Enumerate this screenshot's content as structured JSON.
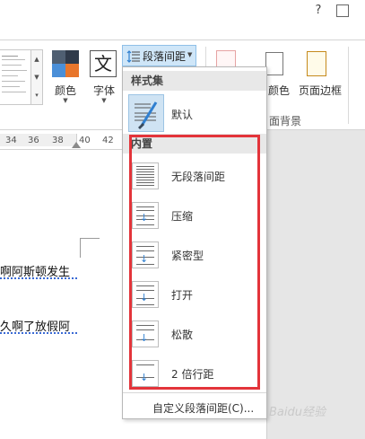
{
  "titlebar": {
    "help": "?",
    "restore": "⊡"
  },
  "ribbon": {
    "color_label": "颜色",
    "font_label": "字体",
    "spacing_button_label": "段落间距",
    "page_color_label": "颜色",
    "page_border_label": "页面边框",
    "page_background_group": "面背景"
  },
  "ruler": {
    "numbers": [
      "34",
      "36",
      "38",
      "40",
      "42"
    ]
  },
  "document": {
    "line1": "啊阿斯顿发生",
    "line2": "久啊了放假阿"
  },
  "menu": {
    "style_set_header": "样式集",
    "default_label": "默认",
    "builtin_header": "内置",
    "items": [
      {
        "label": "无段落间距"
      },
      {
        "label": "压缩"
      },
      {
        "label": "紧密型"
      },
      {
        "label": "打开"
      },
      {
        "label": "松散"
      },
      {
        "label": "2 倍行距"
      }
    ],
    "custom_label": "自定义段落间距(C)..."
  },
  "colors": {
    "highlight": "#e3343a",
    "button_active": "#cfe6f8",
    "arrow_blue": "#2f7fd0"
  },
  "watermark": "Baidu经验"
}
